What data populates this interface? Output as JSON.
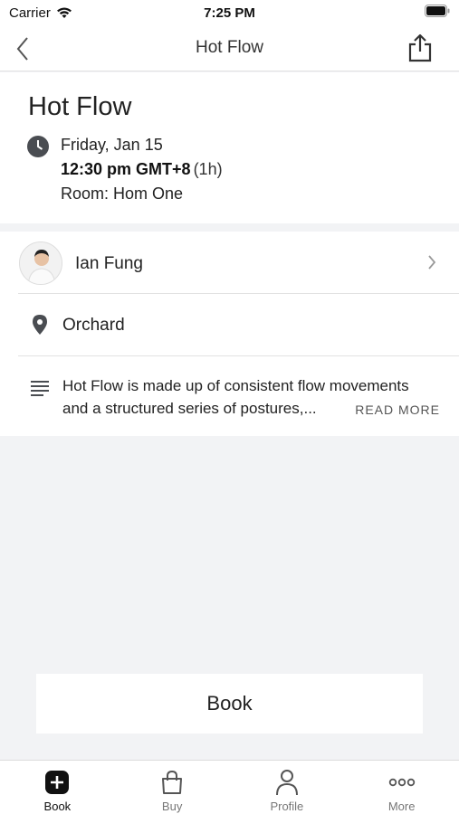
{
  "status_bar": {
    "carrier": "Carrier",
    "time": "7:25 PM"
  },
  "nav": {
    "title": "Hot Flow",
    "back_icon": "chevron-left-icon",
    "share_icon": "share-icon"
  },
  "class_info": {
    "title": "Hot Flow",
    "date": "Friday, Jan 15",
    "time": "12:30 pm GMT+8",
    "duration": "(1h)",
    "room": "Room: Hom One"
  },
  "instructor": {
    "name": "Ian Fung"
  },
  "location": {
    "name": "Orchard"
  },
  "description": {
    "line1": "Hot Flow is made up of consistent flow movements",
    "line2": "and a structured series of postures,...",
    "read_more": "READ MORE"
  },
  "book_button": {
    "label": "Book"
  },
  "tabs": [
    {
      "label": "Book",
      "icon": "plus-square-icon",
      "active": true
    },
    {
      "label": "Buy",
      "icon": "shopping-bag-icon",
      "active": false
    },
    {
      "label": "Profile",
      "icon": "person-icon",
      "active": false
    },
    {
      "label": "More",
      "icon": "more-dots-icon",
      "active": false
    }
  ]
}
